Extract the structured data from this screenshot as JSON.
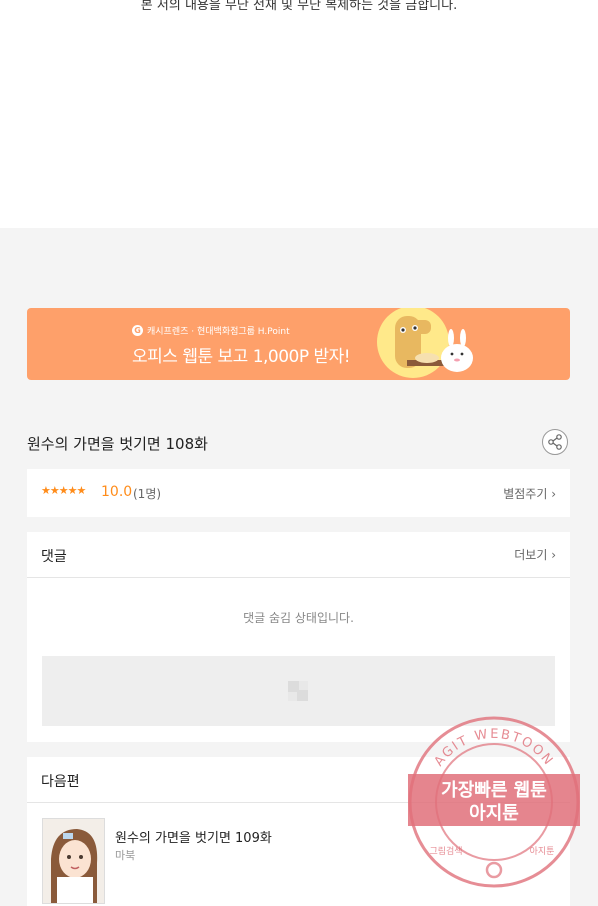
{
  "notice": "본 저의 내용을 무단 전재 및 무단 복제하는 것을 금합니다.",
  "banner": {
    "small": "캐시프렌즈 · 현대백화점그룹 H.Point",
    "big": "오피스 웹툰 보고 1,000P 받자!"
  },
  "episode": {
    "title": "원수의 가면을 벗기면 108화"
  },
  "rating": {
    "stars": "★★★★★",
    "score": "10.0",
    "count": "(1명)",
    "rate_label": "별점주기 ›"
  },
  "comments": {
    "title": "댓글",
    "more": "더보기 ›",
    "hidden_msg": "댓글 숨김 상태입니다."
  },
  "next": {
    "title": "다음편",
    "episode_title": "원수의 가면을 벗기면 109화",
    "author": "마북"
  },
  "watermark": {
    "top_arc": "AGIT WEBTOON",
    "line1": "가장빠른 웹툰",
    "line2": "아지툰",
    "bottom_left": "그림검색",
    "bottom_right": "아지툰"
  },
  "colors": {
    "banner": "#fea06a",
    "star": "#ff8c1a",
    "stamp": "#e0707a"
  }
}
